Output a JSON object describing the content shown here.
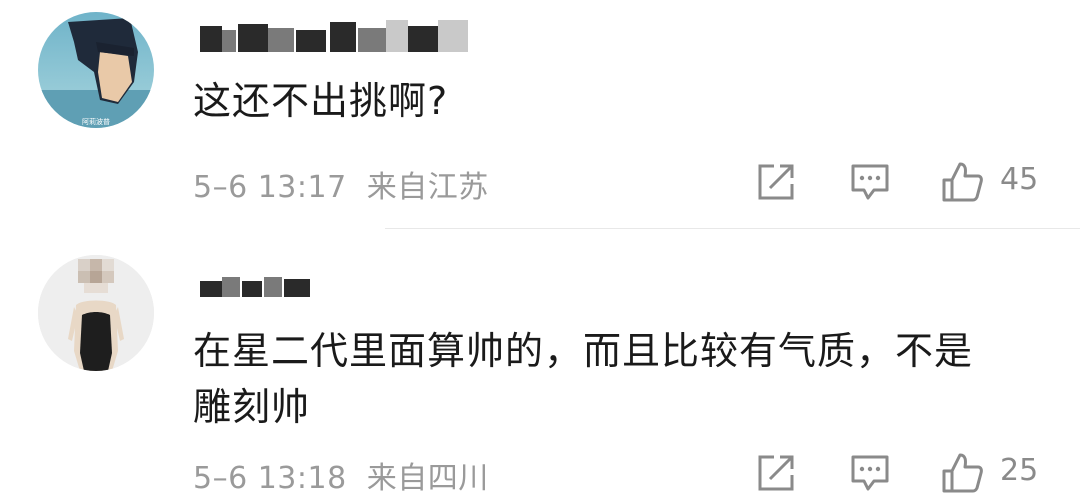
{
  "comments": [
    {
      "text": "这还不出挑啊?",
      "time": "5–6 13:17",
      "location": "来自江苏",
      "likes": "45",
      "avatar_caption": "阿莉波普",
      "icons": [
        "share-icon",
        "comment-icon",
        "like-icon"
      ]
    },
    {
      "text_line1": "在星二代里面算帅的，而且比较有气质，不是",
      "text_line2": "雕刻帅",
      "time": "5–6 13:18",
      "location": "来自四川",
      "likes": "25",
      "icons": [
        "share-icon",
        "comment-icon",
        "like-icon"
      ]
    }
  ],
  "colors": {
    "text": "#1a1a1a",
    "meta": "#9a9a9a",
    "icon": "#8a8a8a",
    "divider": "#e8e8e8"
  }
}
